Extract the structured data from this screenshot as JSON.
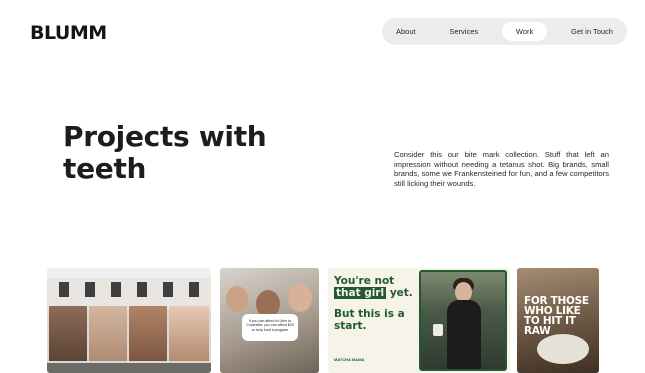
{
  "brand": {
    "logo_text": "BLUMM"
  },
  "nav": {
    "items": [
      {
        "label": "About"
      },
      {
        "label": "Services"
      },
      {
        "label": "Work"
      },
      {
        "label": "Get in Touch"
      }
    ],
    "active": "Work"
  },
  "hero": {
    "title": "Projects with teeth",
    "intro": "Consider this our bite mark collection. Stuff that left an impression without needing a tetanus shot. Big brands, small brands, some we Frankensteined for fun, and a few competitors still licking their wounds."
  },
  "gallery": {
    "cards": [
      {
        "kind": "photo"
      },
      {
        "kind": "photo",
        "bubble_text": "If you can afford to Uber to Coachella, you can afford $20 to help fund a program"
      },
      {
        "kind": "ad",
        "headline_lead": "You're not",
        "headline_highlight": "that girl",
        "headline_tail": "yet.",
        "subhead": "But this is a start.",
        "logo": "MATCHA MAMA"
      },
      {
        "kind": "ad",
        "text": "FOR THOSE WHO LIKE TO HIT IT RAW"
      }
    ]
  },
  "colors": {
    "nav_background": "#ececec",
    "matcha_green": "#1f5a33",
    "matcha_cream": "#f7f3e8"
  }
}
